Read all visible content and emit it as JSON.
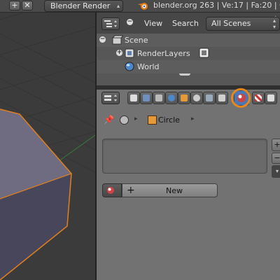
{
  "topbar": {
    "add_icon": "plus-icon",
    "close_icon": "x-icon",
    "render_engine": "Blender Render",
    "stats": "blender.org 263 | Ve:17 | Fa:20 | Ob"
  },
  "outliner": {
    "view_label": "View",
    "search_label": "Search",
    "scope_value": "All Scenes",
    "items": [
      {
        "label": "Scene"
      },
      {
        "label": "RenderLayers"
      },
      {
        "label": "World"
      }
    ]
  },
  "properties": {
    "breadcrumb_object": "Circle",
    "new_button_label": "New"
  },
  "colors": {
    "highlight_ring": "#e8881c",
    "selected_edge": "#e2801f"
  }
}
